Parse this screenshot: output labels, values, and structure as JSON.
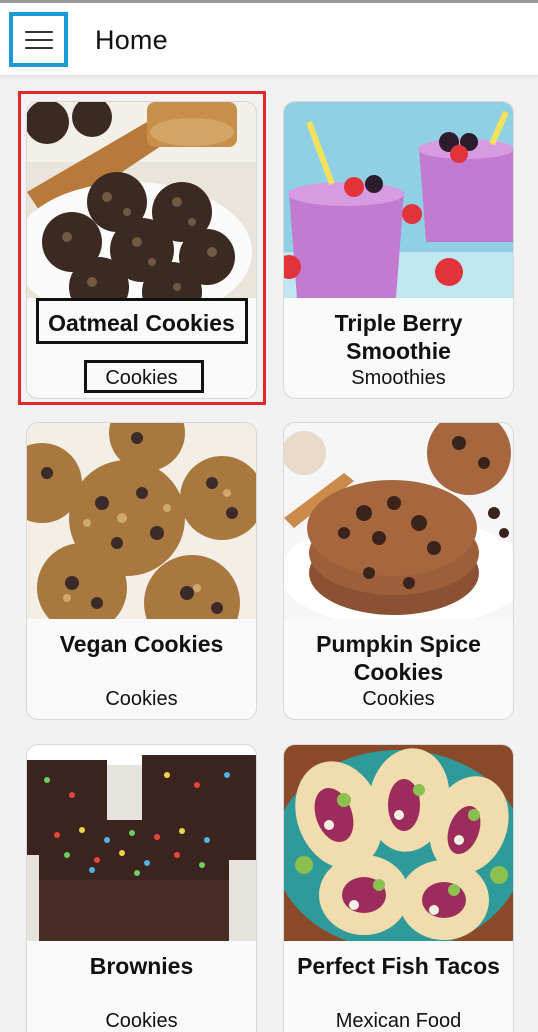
{
  "appbar": {
    "title": "Home",
    "menu_icon": "hamburger-menu-icon"
  },
  "colors": {
    "appbar_bg": "#ffffff",
    "page_bg": "#f2f2f2",
    "menu_focus": "#1a9bd6",
    "selection_outline": "#e02a2a"
  },
  "recipes": [
    {
      "name": "Oatmeal Cookies",
      "category": "Cookies"
    },
    {
      "name": "Triple Berry Smoothie",
      "category": "Smoothies"
    },
    {
      "name": "Vegan Cookies",
      "category": "Cookies"
    },
    {
      "name": "Pumpkin Spice Cookies",
      "category": "Cookies"
    },
    {
      "name": "Brownies",
      "category": "Cookies"
    },
    {
      "name": "Perfect Fish Tacos",
      "category": "Mexican Food"
    }
  ]
}
